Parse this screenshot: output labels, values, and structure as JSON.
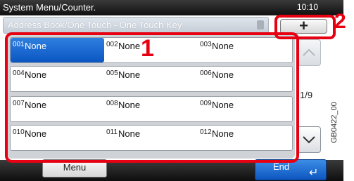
{
  "header": {
    "title": "System Menu/Counter.",
    "clock": "10:10"
  },
  "subheader": {
    "title": "Address Book/One Touch - One Touch Key"
  },
  "add_button": {
    "label": "+"
  },
  "callouts": {
    "list": "1",
    "add": "2"
  },
  "keys": [
    [
      {
        "num": "001",
        "name": "None"
      },
      {
        "num": "002",
        "name": "None"
      },
      {
        "num": "003",
        "name": "None"
      }
    ],
    [
      {
        "num": "004",
        "name": "None"
      },
      {
        "num": "005",
        "name": "None"
      },
      {
        "num": "006",
        "name": "None"
      }
    ],
    [
      {
        "num": "007",
        "name": "None"
      },
      {
        "num": "008",
        "name": "None"
      },
      {
        "num": "009",
        "name": "None"
      }
    ],
    [
      {
        "num": "010",
        "name": "None"
      },
      {
        "num": "011",
        "name": "None"
      },
      {
        "num": "012",
        "name": "None"
      }
    ]
  ],
  "pager": {
    "page": "1/9",
    "up_icon": "chevron-up-icon",
    "down_icon": "chevron-down-icon"
  },
  "footer": {
    "menu_label": "Menu",
    "end_label": "End",
    "enter_icon": "enter-arrow-icon"
  },
  "figure_code": "GB0422_00",
  "colors": {
    "highlight": "#e60012",
    "selected": "#0a56c2",
    "bar": "#1a1a1a"
  }
}
